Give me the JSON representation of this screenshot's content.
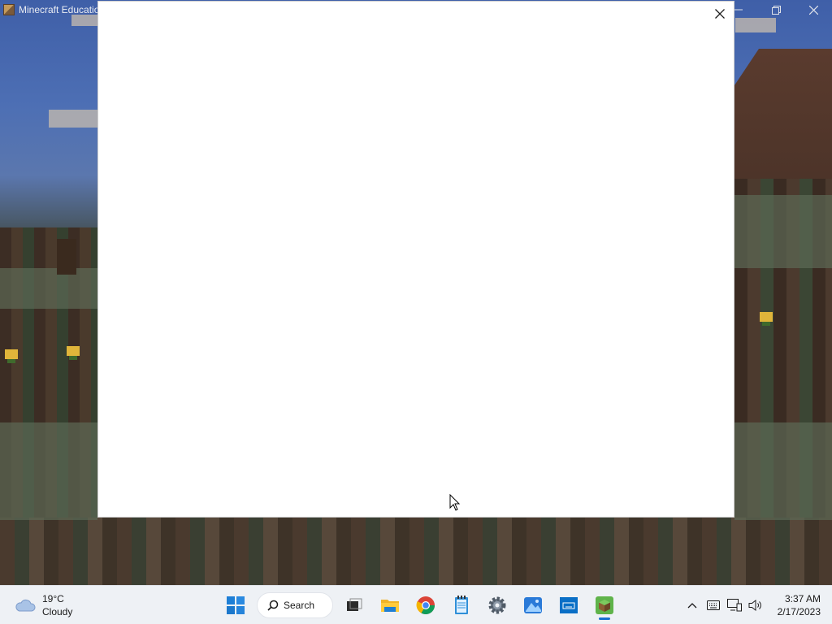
{
  "app": {
    "title": "Minecraft Educatio",
    "icon": "minecraft-block-icon"
  },
  "window_controls": {
    "minimize": "minimize-icon",
    "restore": "restore-icon",
    "close": "close-icon"
  },
  "dialog": {
    "close_icon": "close-icon"
  },
  "taskbar": {
    "weather": {
      "temp": "19°C",
      "condition": "Cloudy",
      "icon": "cloud-icon"
    },
    "search_label": "Search",
    "pinned": [
      "windows-start-icon",
      "task-view-icon",
      "file-explorer-icon",
      "chrome-icon",
      "notepad-icon",
      "settings-icon",
      "photos-icon",
      "keyboard-app-icon",
      "minecraft-icon"
    ],
    "active_app": "minecraft-icon",
    "tray": [
      "chevron-up-icon",
      "keyboard-icon",
      "network-icon",
      "volume-icon"
    ],
    "clock": {
      "time": "3:37 AM",
      "date": "2/17/2023"
    }
  },
  "colors": {
    "accent": "#1a6fd0",
    "taskbar_bg": "#eef1f5",
    "dialog_bg": "#ffffff"
  }
}
